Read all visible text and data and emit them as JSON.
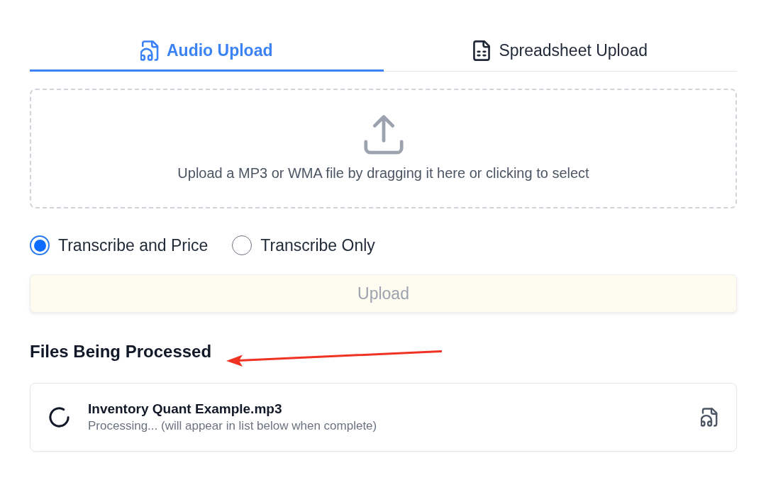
{
  "tabs": [
    {
      "label": "Audio Upload",
      "kind": "audio",
      "selected": true
    },
    {
      "label": "Spreadsheet Upload",
      "kind": "spreadsheet",
      "selected": false
    }
  ],
  "dropzone": {
    "text": "Upload a MP3 or WMA file by dragging it here or clicking to select"
  },
  "modes": [
    {
      "label": "Transcribe and Price",
      "selected": true
    },
    {
      "label": "Transcribe Only",
      "selected": false
    }
  ],
  "upload_button": {
    "label": "Upload",
    "disabled": true
  },
  "processing": {
    "title": "Files Being Processed",
    "annotation": {
      "kind": "arrow"
    },
    "files": [
      {
        "name": "Inventory Quant Example.mp3",
        "status": "Processing... (will appear in list below when complete)",
        "kind": "audio"
      }
    ]
  }
}
